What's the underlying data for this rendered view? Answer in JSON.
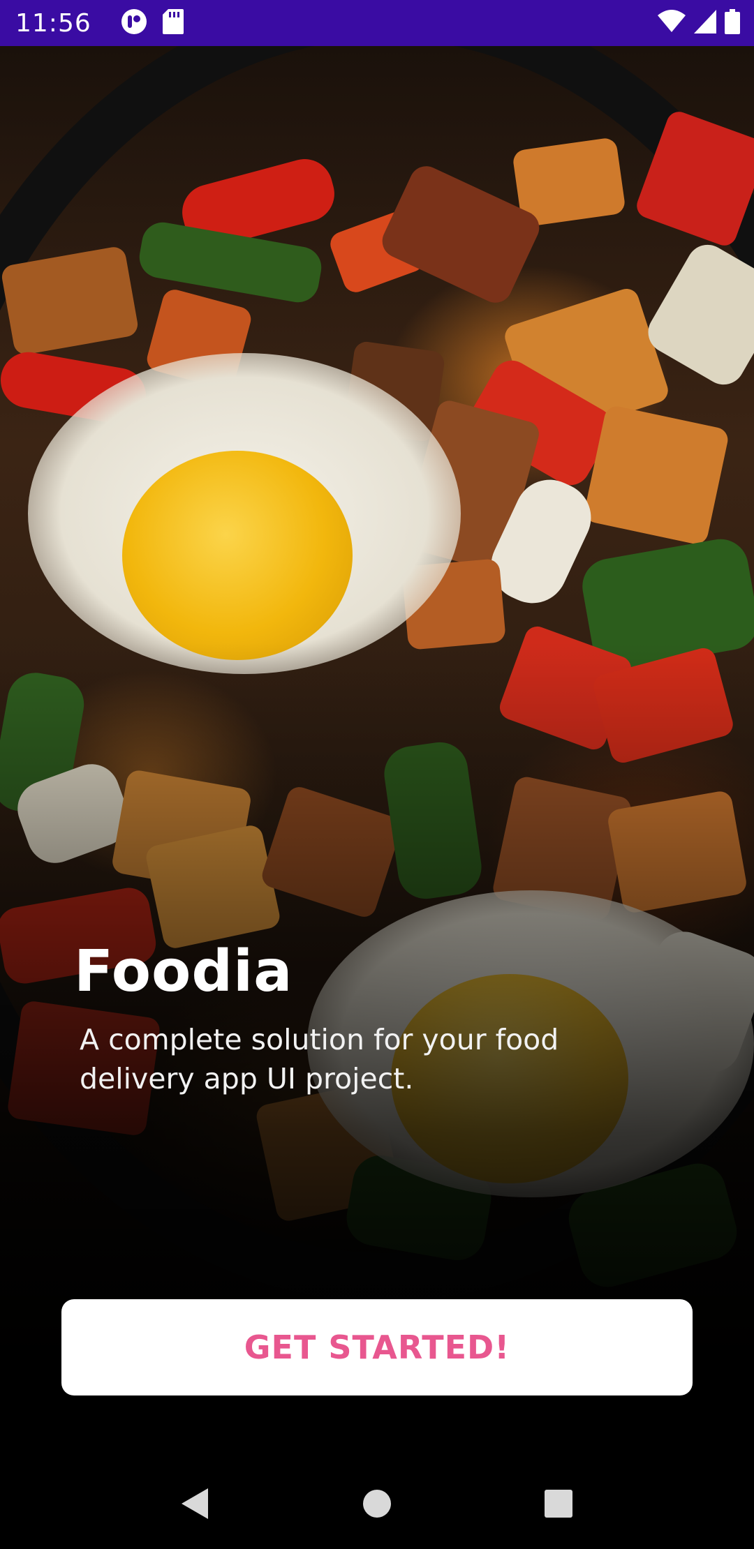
{
  "status_bar": {
    "time": "11:56",
    "left_icons": [
      "app-notification-icon",
      "sd-card-icon"
    ],
    "right_icons": [
      "wifi-icon",
      "signal-icon",
      "battery-icon"
    ],
    "background_color": "#3a0ca3"
  },
  "hero": {
    "image": "food-photo-eggs-sweet-potato-hash"
  },
  "title": "Foodia",
  "subtitle": "A complete solution for your food delivery app UI project.",
  "cta": {
    "label": "GET STARTED!",
    "label_color": "#e8578f"
  },
  "nav_bar": {
    "buttons": [
      "back-icon",
      "home-icon",
      "recents-icon"
    ]
  }
}
